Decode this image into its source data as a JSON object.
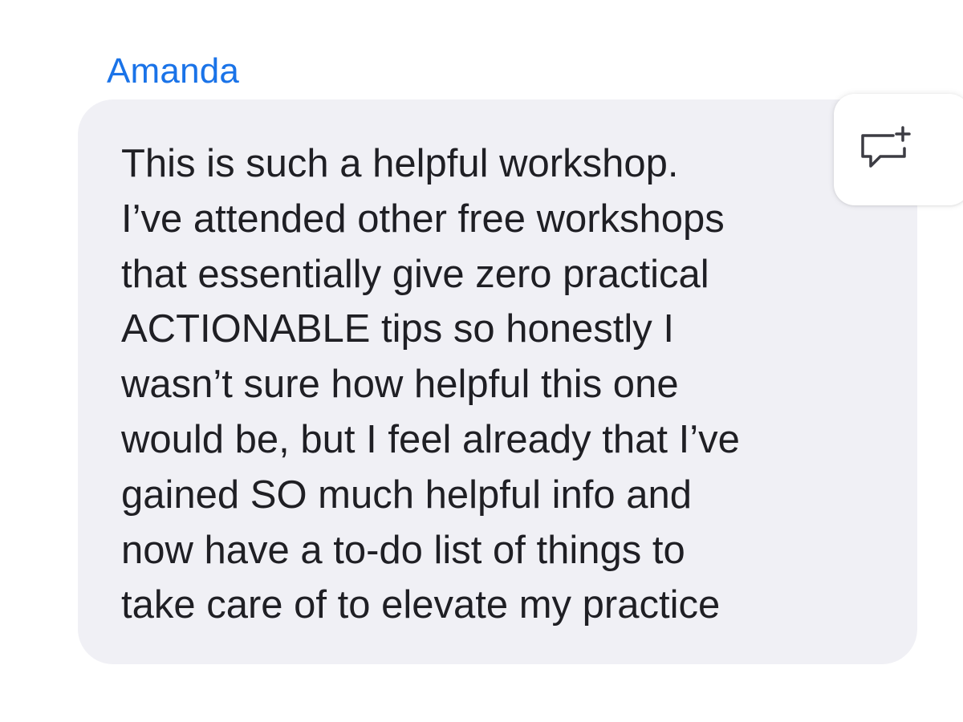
{
  "chat_message": {
    "sender": "Amanda",
    "text": "This is such a helpful workshop.\nI’ve attended other free workshops\nthat essentially give zero practical\nACTIONABLE tips so honestly I\nwasn’t sure how helpful this one\nwould be, but I feel already that I’ve\ngained SO much helpful info and\nnow have a to-do list of things to\ntake care of to elevate my practice"
  },
  "reply_action": {
    "icon": "comment-plus-icon"
  },
  "colors": {
    "sender_name": "#1a73e8",
    "bubble_background": "#f0f0f5",
    "message_text": "#1f1f24",
    "icon_stroke": "#3c3c43"
  }
}
